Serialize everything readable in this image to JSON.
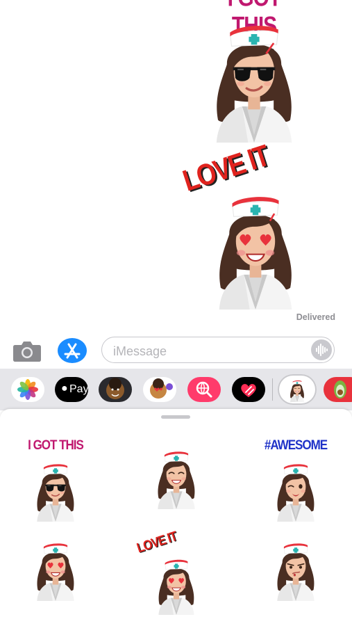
{
  "conversation": {
    "stickers": [
      {
        "caption": "I GOT THIS",
        "expression": "sunglasses"
      },
      {
        "caption": "LOVE IT",
        "expression": "heart-eyes"
      }
    ],
    "status": "Delivered"
  },
  "compose": {
    "placeholder": "iMessage"
  },
  "app_strip": {
    "apps": [
      {
        "name": "photos-app-icon"
      },
      {
        "name": "apple-pay-app-icon",
        "label": "Pay"
      },
      {
        "name": "memoji-app-icon"
      },
      {
        "name": "memoji-stickers-app-icon"
      },
      {
        "name": "web-images-search-icon"
      },
      {
        "name": "digital-touch-heart-icon"
      },
      {
        "name": "nurse-sticker-app-icon",
        "selected": true
      },
      {
        "name": "avocado-sticker-app-icon"
      }
    ]
  },
  "sticker_drawer": {
    "stickers": [
      {
        "caption": "I GOT THIS",
        "caption_color": "#c0186f",
        "expression": "sunglasses"
      },
      {
        "caption": "",
        "expression": "smile"
      },
      {
        "caption": "#AWESOME",
        "caption_color": "#1f32c8",
        "expression": "wink"
      },
      {
        "caption": "",
        "expression": "heart-eyes"
      },
      {
        "caption": "LOVE IT",
        "caption_color": "#e0231e",
        "expression": "heart-eyes"
      },
      {
        "caption": "",
        "expression": "smirk"
      }
    ]
  },
  "colors": {
    "ios_blue": "#1a8cff",
    "love_red": "#e0231e",
    "got_this_magenta": "#c0186f",
    "awesome_blue": "#1f32c8"
  }
}
